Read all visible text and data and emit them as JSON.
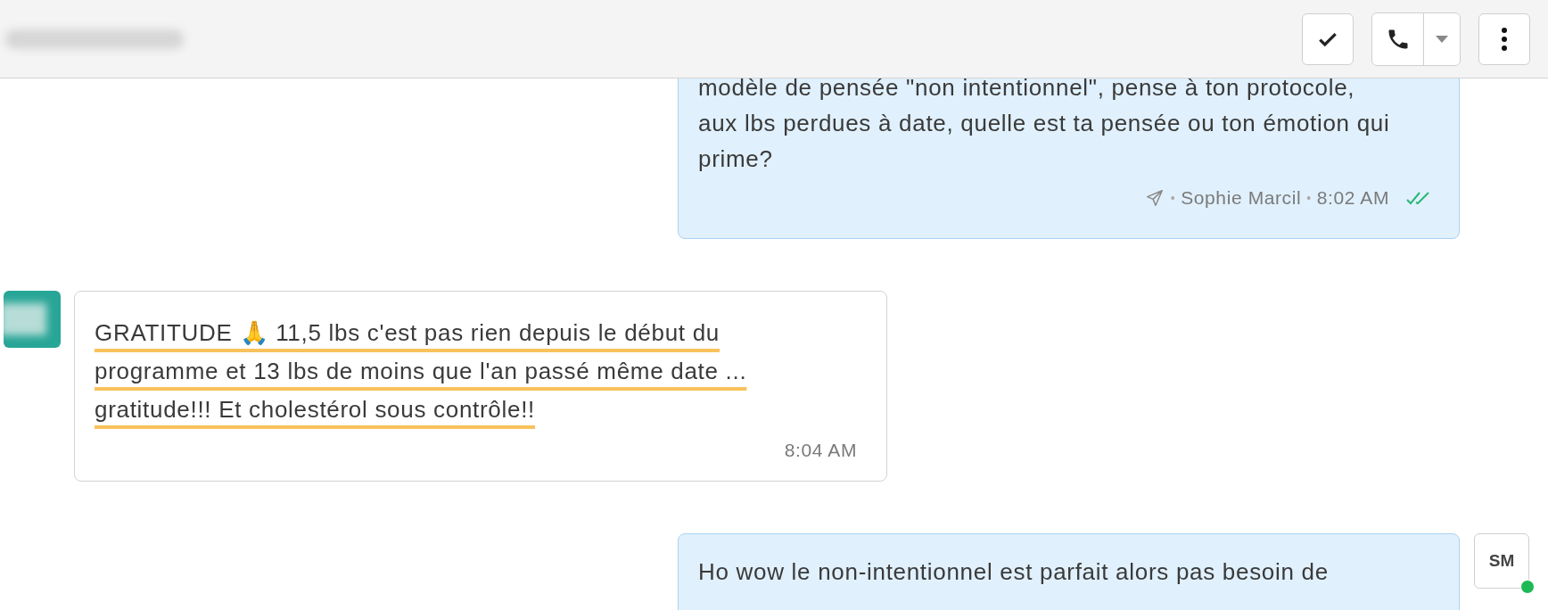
{
  "messages": [
    {
      "kind": "outgoing",
      "text": "modèle de pensée \"non intentionnel\", pense à ton protocole,\naux lbs perdues à date, quelle est ta pensée ou ton émotion qui\nprime?",
      "sender": "Sophie Marcil",
      "separator": "•",
      "time": "8:02 AM",
      "read": true
    },
    {
      "kind": "incoming",
      "text": "GRATITUDE 🙏 11,5 lbs c'est pas rien depuis le début du\nprogramme et 13 lbs de moins que l'an passé même date ...\ngratitude!!! Et cholestérol sous contrôle!!",
      "time": "8:04 AM",
      "annotated": true
    },
    {
      "kind": "outgoing",
      "text": "Ho wow le non-intentionnel est parfait alors pas besoin de",
      "avatar": "SM",
      "online": true
    }
  ]
}
